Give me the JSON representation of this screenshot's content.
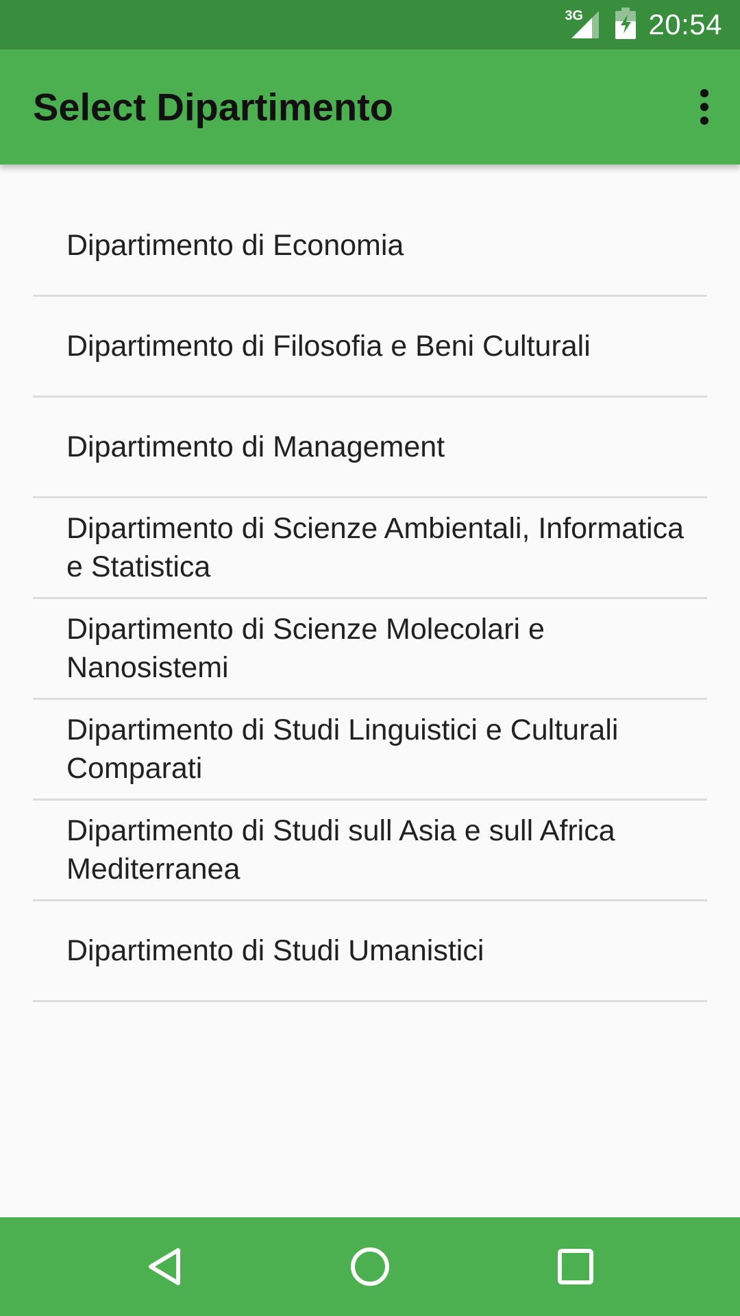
{
  "status_bar": {
    "network": "3G",
    "time": "20:54",
    "icons": [
      "signal-icon",
      "battery-icon"
    ]
  },
  "app_bar": {
    "title": "Select Dipartimento",
    "overflow_icon": "more-vert-icon"
  },
  "departments": [
    "Dipartimento di Economia",
    "Dipartimento di Filosofia e Beni Culturali",
    "Dipartimento di Management",
    "Dipartimento di Scienze Ambientali, Informatica e Statistica",
    "Dipartimento di Scienze Molecolari e Nanosistemi",
    "Dipartimento di Studi Linguistici e Culturali Comparati",
    "Dipartimento di Studi sull Asia e sull Africa Mediterranea",
    "Dipartimento di Studi Umanistici"
  ],
  "nav_bar": {
    "icons": [
      "back-icon",
      "home-icon",
      "recents-icon"
    ]
  },
  "colors": {
    "status_bar": "#388e3c",
    "app_bar": "#4caf50",
    "nav_bar": "#4caf50",
    "background": "#fafafa",
    "divider": "#dcdcdc",
    "text": "#212121"
  }
}
